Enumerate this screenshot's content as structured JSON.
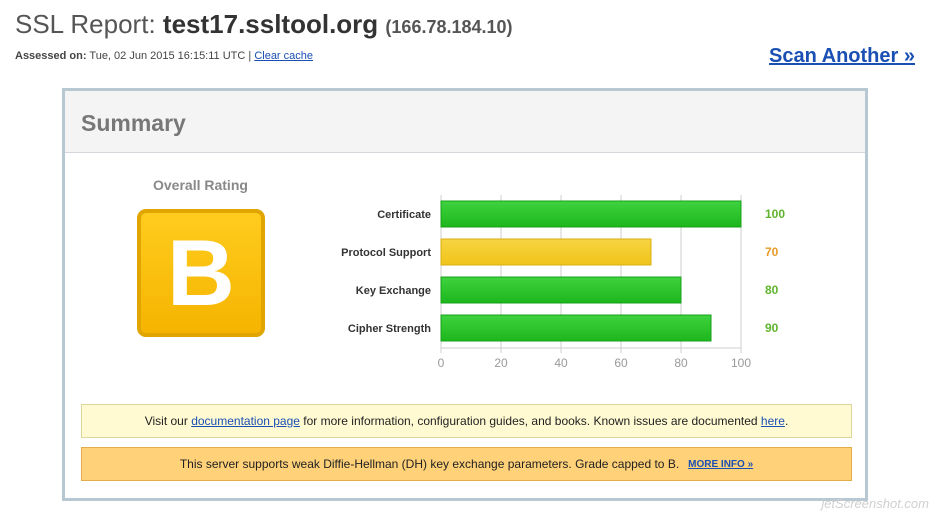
{
  "header": {
    "title_prefix": "SSL Report:",
    "host": "test17.ssltool.org",
    "ip": "(166.78.184.10)",
    "assessed_label": "Assessed on:",
    "assessed_value": "Tue, 02 Jun 2015 16:15:11 UTC |",
    "clear_cache": "Clear cache",
    "scan_another": "Scan Another »"
  },
  "summary": {
    "title": "Summary",
    "overall_label": "Overall Rating",
    "grade": "B"
  },
  "colors": {
    "green": "#1db61d",
    "yellow": "#f0c419",
    "grade_bg": "#ffc61a",
    "score_green": "#5fb42d",
    "score_orange": "#e79a25"
  },
  "chart_data": {
    "type": "bar",
    "orientation": "horizontal",
    "categories": [
      "Certificate",
      "Protocol Support",
      "Key Exchange",
      "Cipher Strength"
    ],
    "values": [
      100,
      70,
      80,
      90
    ],
    "value_labels": [
      "100",
      "70",
      "80",
      "90"
    ],
    "bar_colors": [
      "green",
      "yellow",
      "green",
      "green"
    ],
    "label_colors": [
      "green",
      "orange",
      "green",
      "green"
    ],
    "xlim": [
      0,
      100
    ],
    "ticks": [
      "0",
      "20",
      "40",
      "60",
      "80",
      "100"
    ],
    "grid": true
  },
  "notices": {
    "info": {
      "text1": "Visit our",
      "link1": "documentation page",
      "text2": "for more information, configuration guides, and books. Known issues are documented",
      "link2": "here",
      "text3": "."
    },
    "warn": {
      "text": "This server supports weak Diffie-Hellman (DH) key exchange parameters. Grade capped to B.",
      "link": "MORE INFO »"
    }
  },
  "watermark": "jetScreenshot.com"
}
